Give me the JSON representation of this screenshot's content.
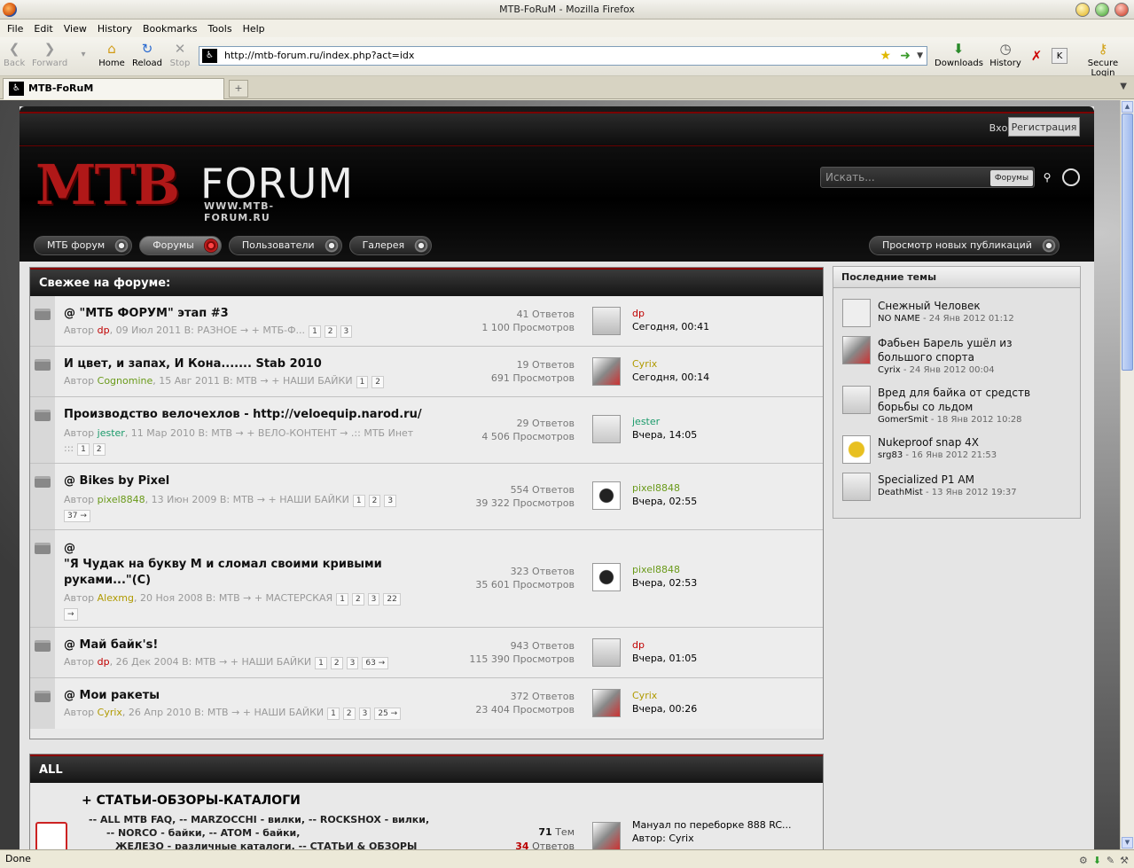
{
  "window": {
    "title": "MTB-FoRuM - Mozilla Firefox"
  },
  "menu": [
    "File",
    "Edit",
    "View",
    "History",
    "Bookmarks",
    "Tools",
    "Help"
  ],
  "nav": {
    "back": "Back",
    "forward": "Forward",
    "home": "Home",
    "reload": "Reload",
    "stop": "Stop",
    "downloads": "Downloads",
    "history": "History",
    "secure_login": "Secure Login"
  },
  "url": "http://mtb-forum.ru/index.php?act=idx",
  "tab": {
    "title": "MTB-FoRuM",
    "new": "+"
  },
  "status": "Done",
  "site": {
    "login": "Вход",
    "register": "Регистрация",
    "logo_main": "MTB",
    "logo_forum": "FORUM",
    "logo_url": "WWW.MTB-FORUM.RU",
    "search_placeholder": "Искать...",
    "search_scope": "Форумы",
    "navtabs": [
      "МТБ форум",
      "Форумы",
      "Пользователи",
      "Галерея"
    ],
    "navtab_right": "Просмотр новых публикаций"
  },
  "fresh": {
    "header": "Свежее на форуме:",
    "topics": [
      {
        "pin": "@",
        "title": "\"МТБ ФОРУМ\" этап #3",
        "author_label": "Автор",
        "author": "dp",
        "author_color": "#c00000",
        "info": ", 09 Июл 2011 В: РАЗНОЕ → + МТБ-Ф...",
        "pages": [
          "1",
          "2",
          "3"
        ],
        "replies": "41 Ответов",
        "views": "1 100 Просмотров",
        "last_user": "dp",
        "last_time": "Сегодня, 00:41"
      },
      {
        "pin": "",
        "title": "И цвет, и запах, И Кона....... Stab 2010",
        "author_label": "Автор",
        "author": "Cognomine",
        "author_color": "#6a9a1a",
        "info": ", 15 Авг 2011 В: МТВ → + НАШИ БАЙКИ",
        "pages": [
          "1",
          "2"
        ],
        "replies": "19 Ответов",
        "views": "691 Просмотров",
        "last_user": "Cyrix",
        "last_time": "Сегодня, 00:14"
      },
      {
        "pin": "",
        "title": "Производство велочехлов - http://veloequip.narod.ru/",
        "author_label": "Автор",
        "author": "jester",
        "author_color": "#1a9a6a",
        "info": ", 11 Мар 2010 В: МТВ → + ВЕЛО-КОНТЕНТ → .:: МТБ Инет",
        "info2": ":::",
        "pages": [
          "1",
          "2"
        ],
        "replies": "29 Ответов",
        "views": "4 506 Просмотров",
        "last_user": "jester",
        "last_time": "Вчера, 14:05"
      },
      {
        "pin": "@",
        "title": "Bikes by Pixel",
        "author_label": "Автор",
        "author": "pixel8848",
        "author_color": "#6a9a1a",
        "info": ", 13 Июн 2009 В: МТВ → + НАШИ БАЙКИ",
        "pages": [
          "1",
          "2",
          "3",
          "37 →"
        ],
        "replies": "554 Ответов",
        "views": "39 322 Просмотров",
        "last_user": "pixel8848",
        "last_time": "Вчера, 02:55"
      },
      {
        "pin": "@",
        "title": "\"Я Чудак на букву М и сломал своими кривыми руками...\"(С)",
        "author_label": "Автор",
        "author": "Alexmg",
        "author_color": "#b09a00",
        "info": ", 20 Ноя 2008 В: МТВ → + МАСТЕРСКАЯ",
        "pages": [
          "1",
          "2",
          "3",
          "22",
          "→"
        ],
        "replies": "323 Ответов",
        "views": "35 601 Просмотров",
        "last_user": "pixel8848",
        "last_time": "Вчера, 02:53"
      },
      {
        "pin": "@",
        "title": "Май байк's!",
        "author_label": "Автор",
        "author": "dp",
        "author_color": "#c00000",
        "info": ", 26 Дек 2004 В: МТВ → + НАШИ БАЙКИ",
        "pages": [
          "1",
          "2",
          "3",
          "63 →"
        ],
        "replies": "943 Ответов",
        "views": "115 390 Просмотров",
        "last_user": "dp",
        "last_time": "Вчера, 01:05"
      },
      {
        "pin": "@",
        "title": "Мои ракеты",
        "author_label": "Автор",
        "author": "Cyrix",
        "author_color": "#b09a00",
        "info": ", 26 Апр 2010 В: МТВ → + НАШИ БАЙКИ",
        "pages": [
          "1",
          "2",
          "3",
          "25 →"
        ],
        "replies": "372 Ответов",
        "views": "23 404 Просмотров",
        "last_user": "Cyrix",
        "last_time": "Вчера, 00:26"
      }
    ]
  },
  "recent": {
    "header": "Последние темы",
    "items": [
      {
        "title": "Снежный Человек",
        "user": "NO NAME",
        "date": " - 24 Янв 2012 01:12"
      },
      {
        "title": "Фабьен Барель ушёл из большого спорта",
        "user": "Cyrix",
        "date": " - 24 Янв 2012 00:04"
      },
      {
        "title": "Вред для байка от средств борьбы со льдом",
        "user": "GomerSmit",
        "date": " - 18 Янв 2012 10:28"
      },
      {
        "title": "Nukeproof snap 4X",
        "user": "srg83",
        "date": " - 16 Янв 2012 21:53"
      },
      {
        "title": "Specialized P1 AM",
        "user": "DeathMist",
        "date": " - 13 Янв 2012 19:37"
      }
    ]
  },
  "all": {
    "header": "ALL",
    "cat_title": "+ СТАТЬИ-ОБЗОРЫ-КАТАЛОГИ",
    "sub1": "-- ALL MTB FAQ,   -- MARZOCCHI - вилки,   -- ROCKSHOX - вилки,",
    "sub2": "-- NORCO - байки,   -- ATOM - байки,",
    "sub3": "ЖЕЛЕЗО - различные каталоги,   -- СТАТЬИ & ОБЗОРЫ",
    "topics_count": "71",
    "topics_label": "Тем",
    "replies_count": "34",
    "replies_label": "Ответов",
    "last_title": "Мануал по переборке 888 RC...",
    "last_author": "Автор: Cyrix"
  }
}
